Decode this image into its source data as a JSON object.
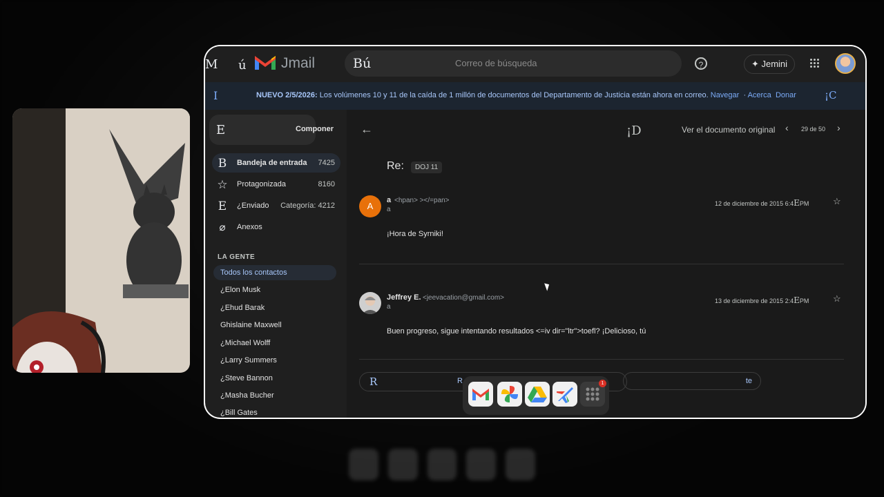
{
  "app": {
    "name": "Jmail",
    "menu_glyph": "ú",
    "left_glyph": "M"
  },
  "search": {
    "glyph": "Bú",
    "placeholder": "Correo de búsqueda"
  },
  "header": {
    "help_icon": "help-circle-icon",
    "jemini_label": "Jemini",
    "apps_icon": "apps-grid-icon"
  },
  "banner": {
    "left_glyph": "I",
    "bold": "NUEVO 2/5/2026:",
    "text": " Los volúmenes 10 y 11 de la caída de 1 millón de documentos del Departamento de Justicia están ahora en correo.",
    "link_navigate": "Navegar",
    "link_about": "Acerca",
    "link_donate": "Donar",
    "right_glyph": "¡C"
  },
  "sidebar": {
    "compose": {
      "glyph": "E",
      "label": "Componer"
    },
    "items": [
      {
        "glyph": "B",
        "label": "Bandeja de entrada",
        "count": "7425"
      },
      {
        "glyph": "☆",
        "label": "Protagonizada",
        "count": "8160"
      },
      {
        "glyph": "E",
        "label": "¿Enviado",
        "count": "Categoría: 4212"
      },
      {
        "glyph": "⌀",
        "label": "Anexos",
        "count": ""
      }
    ],
    "section_title": "LA GENTE",
    "contacts": [
      "Todos los contactos",
      "¿Elon Musk",
      "¿Ehud Barak",
      "Ghislaine Maxwell",
      "¿Michael Wolff",
      "¿Larry Summers",
      "¿Steve Bannon",
      "¿Masha Bucher",
      "¿Bill Gates"
    ]
  },
  "toolbar": {
    "back_icon": "arrow-left-icon",
    "glyph": "¡D",
    "view_original": "Ver el documento original",
    "pager": "29 de 50"
  },
  "thread": {
    "subject": "Re:",
    "label": "DOJ 11",
    "messages": [
      {
        "avatar_letter": "A",
        "sender": "a",
        "address": "<hpan> ></=pan>",
        "to": "a",
        "date": "12 de diciembre de 2015 6:4",
        "date_glyph": "E",
        "date_suffix": "PM",
        "body": "¡Hora de Syrniki!"
      },
      {
        "avatar_letter": "",
        "sender": "Jeffrey E.",
        "address": "<jeevacation@gmail.com>",
        "to": "a",
        "date": "13 de diciembre de 2015 2:4",
        "date_glyph": "E",
        "date_suffix": "PM",
        "body": "Buen progreso, sigue intentando resultados <=iv dir=\"ltr\">toefl? ¡Delicioso, tú"
      }
    ],
    "reply_glyph": "R",
    "reply_partial": "R",
    "forward_partial": "te"
  },
  "dock": {
    "apps": [
      "gmail-app-icon",
      "photos-app-icon",
      "drive-app-icon",
      "flights-app-icon",
      "app-launcher-icon"
    ],
    "badge": "1"
  },
  "colors": {
    "accent": "#a8c7fa",
    "avatar_a": "#e8710a",
    "badge": "#d93025"
  }
}
